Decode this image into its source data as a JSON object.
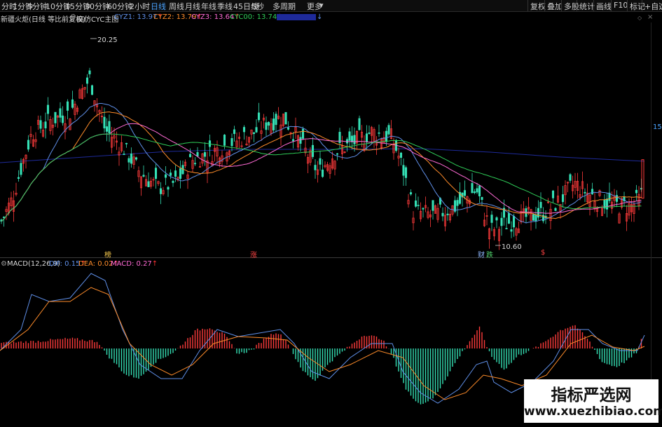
{
  "toolbar": {
    "timeframes": [
      "分时",
      "1分钟",
      "5分钟",
      "10分钟",
      "15分钟",
      "30分钟",
      "60分钟",
      "2小时",
      "日线",
      "周线",
      "月线",
      "年线",
      "季线",
      "45日线",
      "5秒",
      "多周期",
      "更多"
    ],
    "current_timeframe": "日线",
    "more_arrow": "▾",
    "right_buttons": [
      "复权",
      "叠加",
      "多股",
      "统计",
      "画线",
      "F10",
      "标记",
      "+自选"
    ]
  },
  "indicator_line": {
    "stock": "新疆火炬(日线 等比前复权)",
    "indicator": "高仿CYC主图",
    "items": [
      {
        "label": "CYZ1: 13.97",
        "color": "#5f8fe8",
        "arrow": "↑",
        "arrow_color": "#ff3333"
      },
      {
        "label": "CYZ2: 13.79",
        "color": "#ff8c2a",
        "arrow": "↑",
        "arrow_color": "#ff3333"
      },
      {
        "label": "CYZ3: 13.64",
        "color": "#ff6ad5",
        "arrow": "↑",
        "arrow_color": "#ff3333"
      },
      {
        "label": "CYC00: 13.74",
        "color": "#2fcc58",
        "arrow": "↑",
        "arrow_color": "#ff3333"
      }
    ],
    "last_arrow": "↓"
  },
  "macd_line": {
    "name": "MACD(12,26,9)",
    "items": [
      {
        "label": "DIF: 0.15",
        "color": "#5f8fe8",
        "arrow": "↑"
      },
      {
        "label": "DEA: 0.02",
        "color": "#ff8c2a",
        "arrow": "↑"
      },
      {
        "label": "MACD: 0.27",
        "color": "#ff6ad5",
        "arrow": "↑"
      }
    ]
  },
  "price_marks": {
    "high": "20.25",
    "low": "10.60"
  },
  "event_marks": [
    {
      "text": "榜",
      "color": "#f1c44b"
    },
    {
      "text": "涨",
      "color": "#ff4444"
    },
    {
      "text": "财",
      "color": "#8fb8ff"
    },
    {
      "text": "跌",
      "color": "#4fd06a"
    },
    {
      "text": "$",
      "color": "#ff4444"
    }
  ],
  "right_axis_label": "15",
  "watermark": {
    "line1": "指标严选网",
    "line2": "www.xuezhibiao.com"
  },
  "colors": {
    "up": "#ff3b3b",
    "down": "#35e0b5",
    "dif": "#5f8fe8",
    "dea": "#ff8c2a",
    "cyz3": "#ff6ad5",
    "cyc": "#2fcc58",
    "level": "#1e2a9a"
  },
  "chart_data": {
    "type": "candlestick",
    "price_high": 20.25,
    "price_low": 10.6,
    "indicator": "MACD(12,26,9)",
    "dif": 0.15,
    "dea": 0.02,
    "macd": 0.27
  }
}
